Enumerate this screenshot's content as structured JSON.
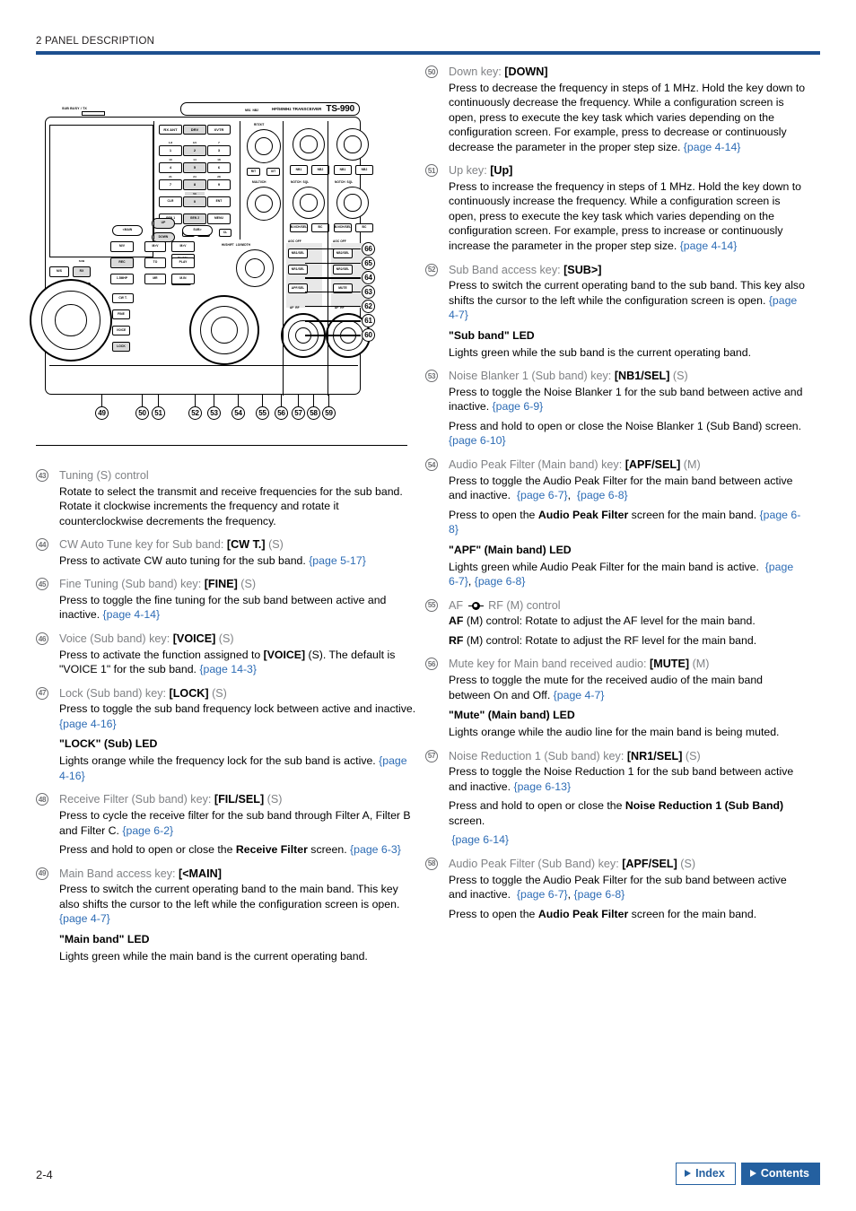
{
  "header": {
    "title": "2 PANEL DESCRIPTION"
  },
  "diagram": {
    "model_prefix": "HF/50MHz TRANSCEIVER",
    "model_name": "TS-990",
    "busy_label": "SUB BUSY / TX",
    "keypad": [
      {
        "key": "RX ANT",
        "band": ""
      },
      {
        "key": "DRV",
        "band": ""
      },
      {
        "key": "XVTR",
        "band": ""
      },
      {
        "key": "1",
        "band": "1.8"
      },
      {
        "key": "2",
        "band": "3.5"
      },
      {
        "key": "3",
        "band": "7"
      },
      {
        "key": "4",
        "band": "10"
      },
      {
        "key": "5",
        "band": "14"
      },
      {
        "key": "6",
        "band": "18"
      },
      {
        "key": "7",
        "band": "21"
      },
      {
        "key": "8",
        "band": "24"
      },
      {
        "key": "9",
        "band": "28"
      },
      {
        "key": "CLR",
        "band": ""
      },
      {
        "key": "0",
        "band": "50"
      },
      {
        "key": "ENT",
        "band": ""
      },
      {
        "key": "GEN 1",
        "band": ""
      },
      {
        "key": "GEN 2",
        "band": ""
      },
      {
        "key": "MENU",
        "band": ""
      }
    ],
    "left_keys": [
      "M/S",
      "RX",
      "TX",
      "TF SET"
    ],
    "sub_label": "SUB",
    "memory_keys": [
      "M/V",
      "REC",
      "1.5MHP",
      "M.IN",
      "PLAY",
      "M>V"
    ],
    "mem_small": [
      "M>V",
      "A/B",
      "SPLIT",
      "SEL",
      "TO",
      "MR"
    ],
    "access_keys": [
      "<MAIN",
      "UP",
      "DOWN",
      "SUB>"
    ],
    "sub_small_keys": [
      "CW T.",
      "FINE",
      "VOICE",
      "LOCK",
      "FIL/SEL"
    ],
    "knob_labels": [
      "RIT/XIT",
      "MULTI/CH",
      "NB1",
      "NB2",
      "NOTCH",
      "SQL",
      "HI/SHIFT",
      "LO/WIDTH",
      "AGC",
      "AF",
      "RF"
    ],
    "dsp_keys": [
      "NB1/SEL",
      "NB2/SEL",
      "NR1/SEL",
      "NR2/SEL",
      "APF/SEL",
      "MUTE",
      "B.NCH/SEL",
      "BC",
      "AGC OFF"
    ],
    "rit_keys": [
      "RIT",
      "XIT",
      "ATT",
      "ATU",
      "CL"
    ],
    "callouts_right": [
      "66",
      "65",
      "64",
      "63",
      "62",
      "61",
      "60"
    ],
    "callouts_bottom": [
      "49",
      "50",
      "51",
      "52",
      "53",
      "54",
      "55",
      "56",
      "57",
      "58",
      "59"
    ]
  },
  "left_items": [
    {
      "num": "43",
      "title_plain": "Tuning (S) control",
      "paras": [
        {
          "html": "Rotate to select the transmit and receive frequencies for the sub band. Rotate it clockwise increments the frequency and rotate it counterclockwise decrements the frequency."
        }
      ]
    },
    {
      "num": "44",
      "title_html": "CW Auto Tune key for Sub band: <b>[CW T.]</b> (S)",
      "paras": [
        {
          "html": "Press to activate CW auto tuning for the sub band. <span class=\"ref\">{page 5-17}</span>"
        }
      ]
    },
    {
      "num": "45",
      "title_html": "Fine Tuning (Sub band) key: <b>[FINE]</b> (S)",
      "paras": [
        {
          "html": "Press to toggle the fine tuning for the sub band between active and inactive. <span class=\"ref\">{page 4-14}</span>"
        }
      ]
    },
    {
      "num": "46",
      "title_html": "Voice (Sub band) key: <b>[VOICE]</b> (S)",
      "paras": [
        {
          "html": "Press to activate the function assigned to <b>[VOICE]</b> (S). The default is \"VOICE 1\" for the sub band. <span class=\"ref\">{page 14-3}</span>"
        }
      ]
    },
    {
      "num": "47",
      "title_html": "Lock (Sub band) key: <b>[LOCK]</b> (S)",
      "paras": [
        {
          "html": "Press to toggle the sub band frequency lock between active and inactive. <span class=\"ref\">{page 4-16}</span>"
        }
      ],
      "led_head": "\"LOCK\" (Sub) LED",
      "led_paras": [
        {
          "html": "Lights orange while the frequency lock for the sub band is active. <span class=\"ref\">{page 4-16}</span>"
        }
      ]
    },
    {
      "num": "48",
      "title_html": "Receive Filter (Sub band) key: <b>[FIL/SEL]</b> (S)",
      "paras": [
        {
          "html": "Press to cycle the receive filter for the sub band through Filter A, Filter B and Filter C. <span class=\"ref\">{page 6-2}</span>"
        },
        {
          "html": "Press and hold to open or close the <b>Receive Filter</b> screen. <span class=\"ref\">{page 6-3}</span>"
        }
      ]
    },
    {
      "num": "49",
      "title_html": "Main Band access key: <b>[&lt;MAIN]</b>",
      "paras": [
        {
          "html": "Press to switch the current operating band to the main band. This key also shifts the cursor to the left while the configuration screen is open. <span class=\"ref\">{page 4-7}</span>"
        }
      ],
      "led_head": "\"Main band\" LED",
      "led_paras": [
        {
          "html": "Lights green while the main band is the current operating band."
        }
      ]
    }
  ],
  "right_items": [
    {
      "num": "50",
      "title_html": "Down key: <b>[DOWN]</b>",
      "paras": [
        {
          "html": "Press to decrease the frequency in steps of 1 MHz. Hold the key down to continuously decrease the frequency. While a configuration screen is open, press to execute the key task which varies depending on the configuration screen. For example, press to decrease or continuously decrease the parameter in the proper step size. <span class=\"ref\">{page 4-14}</span>"
        }
      ]
    },
    {
      "num": "51",
      "title_html": "Up key: <b>[Up]</b>",
      "paras": [
        {
          "html": "Press to increase the frequency in steps of 1 MHz. Hold the key down to continuously increase the frequency. While a configuration screen is open, press to execute the key task which varies depending on the configuration screen. For example, press to increase or continuously increase the parameter in the proper step size. <span class=\"ref\">{page 4-14}</span>"
        }
      ]
    },
    {
      "num": "52",
      "title_html": "Sub Band access key: <b>[SUB&gt;]</b>",
      "paras": [
        {
          "html": "Press to switch the current operating band to the sub band. This key also shifts the cursor to the left while the configuration screen is open. <span class=\"ref\">{page 4-7}</span>"
        }
      ],
      "led_head": "\"Sub band\" LED",
      "led_paras": [
        {
          "html": "Lights green while the sub band is the current operating band."
        }
      ]
    },
    {
      "num": "53",
      "title_html": "Noise Blanker 1 (Sub band) key: <b>[NB1/SEL]</b> (S)",
      "paras": [
        {
          "html": "Press to toggle the Noise Blanker 1 for the sub band between active and inactive. <span class=\"ref\">{page 6-9}</span>"
        },
        {
          "html": "Press and hold to open or close the Noise Blanker 1 (Sub Band) screen. <span class=\"ref\">{page 6-10}</span>"
        }
      ]
    },
    {
      "num": "54",
      "title_html": "Audio Peak Filter (Main band) key: <b>[APF/SEL]</b> (M)",
      "paras": [
        {
          "html": "Press to toggle the Audio Peak Filter for the main band between active and inactive.&nbsp; <span class=\"ref\">{page 6-7}</span>,&nbsp; <span class=\"ref\">{page 6-8}</span>"
        },
        {
          "html": "Press to open the <b>Audio Peak Filter</b> screen for the main band. <span class=\"ref\">{page 6-8}</span>"
        }
      ],
      "led_head": "\"APF\" (Main band) LED",
      "led_paras": [
        {
          "html": "Lights green while Audio Peak Filter for the main band is active.&nbsp; <span class=\"ref\">{page 6-7}</span>, <span class=\"ref\">{page 6-8}</span>"
        }
      ]
    },
    {
      "num": "55",
      "title_html": "AF <span class=\"afrf-glyph\"><span class=\"bar\"></span><span class=\"ring\"></span><span class=\"dot\"></span></span> RF (M) control",
      "paras": [
        {
          "html": "<b>AF</b> (M) control: Rotate to adjust the AF level for the main band."
        },
        {
          "html": "<b>RF</b> (M) control: Rotate to adjust the RF level for the main band."
        }
      ]
    },
    {
      "num": "56",
      "title_html": "Mute key for Main band received audio: <b>[MUTE]</b> (M)",
      "paras": [
        {
          "html": "Press to toggle the mute for the received audio of the main band between On and Off. <span class=\"ref\">{page 4-7}</span>"
        }
      ],
      "led_head": "\"Mute\" (Main band) LED",
      "led_paras": [
        {
          "html": "Lights orange while the audio line for the main band is being muted."
        }
      ]
    },
    {
      "num": "57",
      "title_html": "Noise Reduction 1 (Sub band) key: <b>[NR1/SEL]</b> (S)",
      "paras": [
        {
          "html": "Press to toggle the Noise Reduction 1 for the sub band between active and inactive. <span class=\"ref\">{page 6-13}</span>"
        },
        {
          "html": "Press and hold to open or close the <b>Noise Reduction 1 (Sub Band)</b> screen."
        },
        {
          "html": "<span class=\"ref\">&nbsp;{page 6-14}</span>"
        }
      ]
    },
    {
      "num": "58",
      "title_html": "Audio Peak Filter (Sub Band) key: <b>[APF/SEL]</b> (S)",
      "paras": [
        {
          "html": "Press to toggle the Audio Peak Filter for the sub band between active and inactive.&nbsp; <span class=\"ref\">{page 6-7}</span>, <span class=\"ref\">{page 6-8}</span>"
        },
        {
          "html": "Press to open the <b>Audio Peak Filter</b> screen for the main band."
        }
      ]
    }
  ],
  "footer": {
    "page_number": "2-4",
    "index_label": "Index",
    "contents_label": "Contents",
    "accent_color": "#2460a0"
  }
}
